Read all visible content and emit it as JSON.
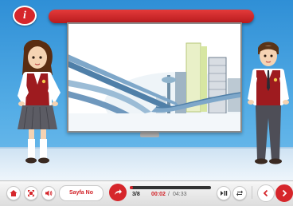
{
  "header": {
    "info_glyph": "i"
  },
  "controls": {
    "page_button_label": "Sayfa No",
    "page_counter": "3/8",
    "time_current": "00:02",
    "time_separator": "/",
    "time_total": "04:33",
    "progress_fraction": 0.02
  },
  "icons": {
    "home": "home-icon",
    "fullscreen": "fullscreen-icon",
    "volume": "volume-icon",
    "go": "go-arrow-icon",
    "play_pause": "play-pause-icon",
    "repeat": "repeat-icon",
    "prev": "chevron-left-icon",
    "next": "chevron-right-icon"
  },
  "colors": {
    "accent": "#d6262b",
    "sky": "#2f8fd6"
  }
}
